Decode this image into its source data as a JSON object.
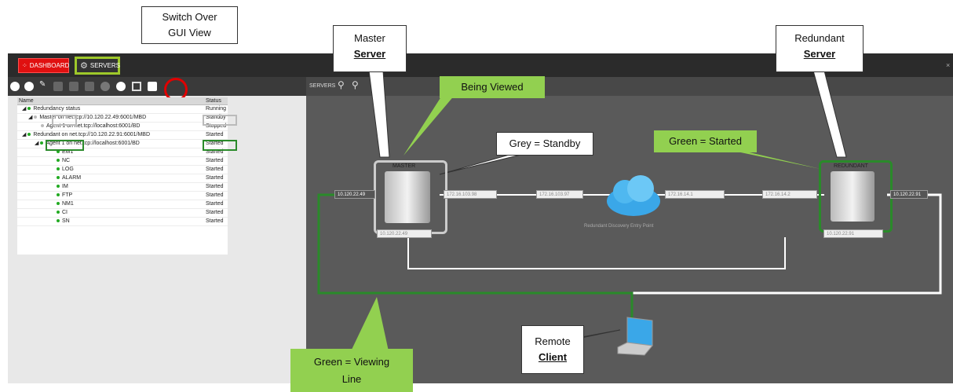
{
  "tabs": {
    "dashboard": "DASHBOARD",
    "servers": "SERVERS"
  },
  "close": "×",
  "tree": {
    "col_name": "Name",
    "col_status": "Status",
    "rows": [
      {
        "name": "Redundancy status",
        "status": "Running"
      },
      {
        "name": "Master",
        "suffix": "on net.tcp://10.120.22.49:6001/MBD",
        "status": "Standby"
      },
      {
        "name": "Agent 1 on net.tcp://localhost:6001/BD",
        "status": "Stopped"
      },
      {
        "name": "Redundant",
        "suffix": "on net.tcp://10.120.22.91:6001/MBD",
        "status": "Started"
      },
      {
        "name": "Agent 1 on net.tcp://localhost:6001/BD",
        "status": "Started"
      },
      {
        "name": "EM1",
        "status": "Started"
      },
      {
        "name": "NC",
        "status": "Started"
      },
      {
        "name": "LOG",
        "status": "Started"
      },
      {
        "name": "ALARM",
        "status": "Started"
      },
      {
        "name": "IM",
        "status": "Started"
      },
      {
        "name": "FTP",
        "status": "Started"
      },
      {
        "name": "NM1",
        "status": "Started"
      },
      {
        "name": "CI",
        "status": "Started"
      },
      {
        "name": "SN",
        "status": "Started"
      }
    ]
  },
  "rightbar": {
    "label": "SERVERS"
  },
  "diagram": {
    "master_title": "MASTER",
    "redundant_title": "REDUNDANT",
    "ip_master_left": "10.120.22.49",
    "ip_master_below": "10.120.22.49",
    "ip_master_right": "172.16.103.98",
    "ip_mid_left": "172.16.103.97",
    "ip_mid_right": "172.16.14.1",
    "ip_red_left": "172.16.14.2",
    "ip_red_below": "10.120.22.91",
    "ip_red_right": "10.120.22.91",
    "discovery": "Redundant Discovery Entry Point"
  },
  "callouts": {
    "switch_over": "Switch Over\nGUI View",
    "master_line1": "Master",
    "master_line2": "Server",
    "being_viewed": "Being Viewed",
    "grey_standby": "Grey = Standby",
    "green_started": "Green = Started",
    "redundant_line1": "Redundant",
    "redundant_line2": "Server",
    "remote_line1": "Remote",
    "remote_line2": "Client",
    "green_viewing": "Green  = Viewing\nLine"
  },
  "colors": {
    "accent_green": "#92d050",
    "line_green": "#2a8a2a",
    "dashboard_red": "#e01010",
    "highlight_red": "#e00000"
  }
}
